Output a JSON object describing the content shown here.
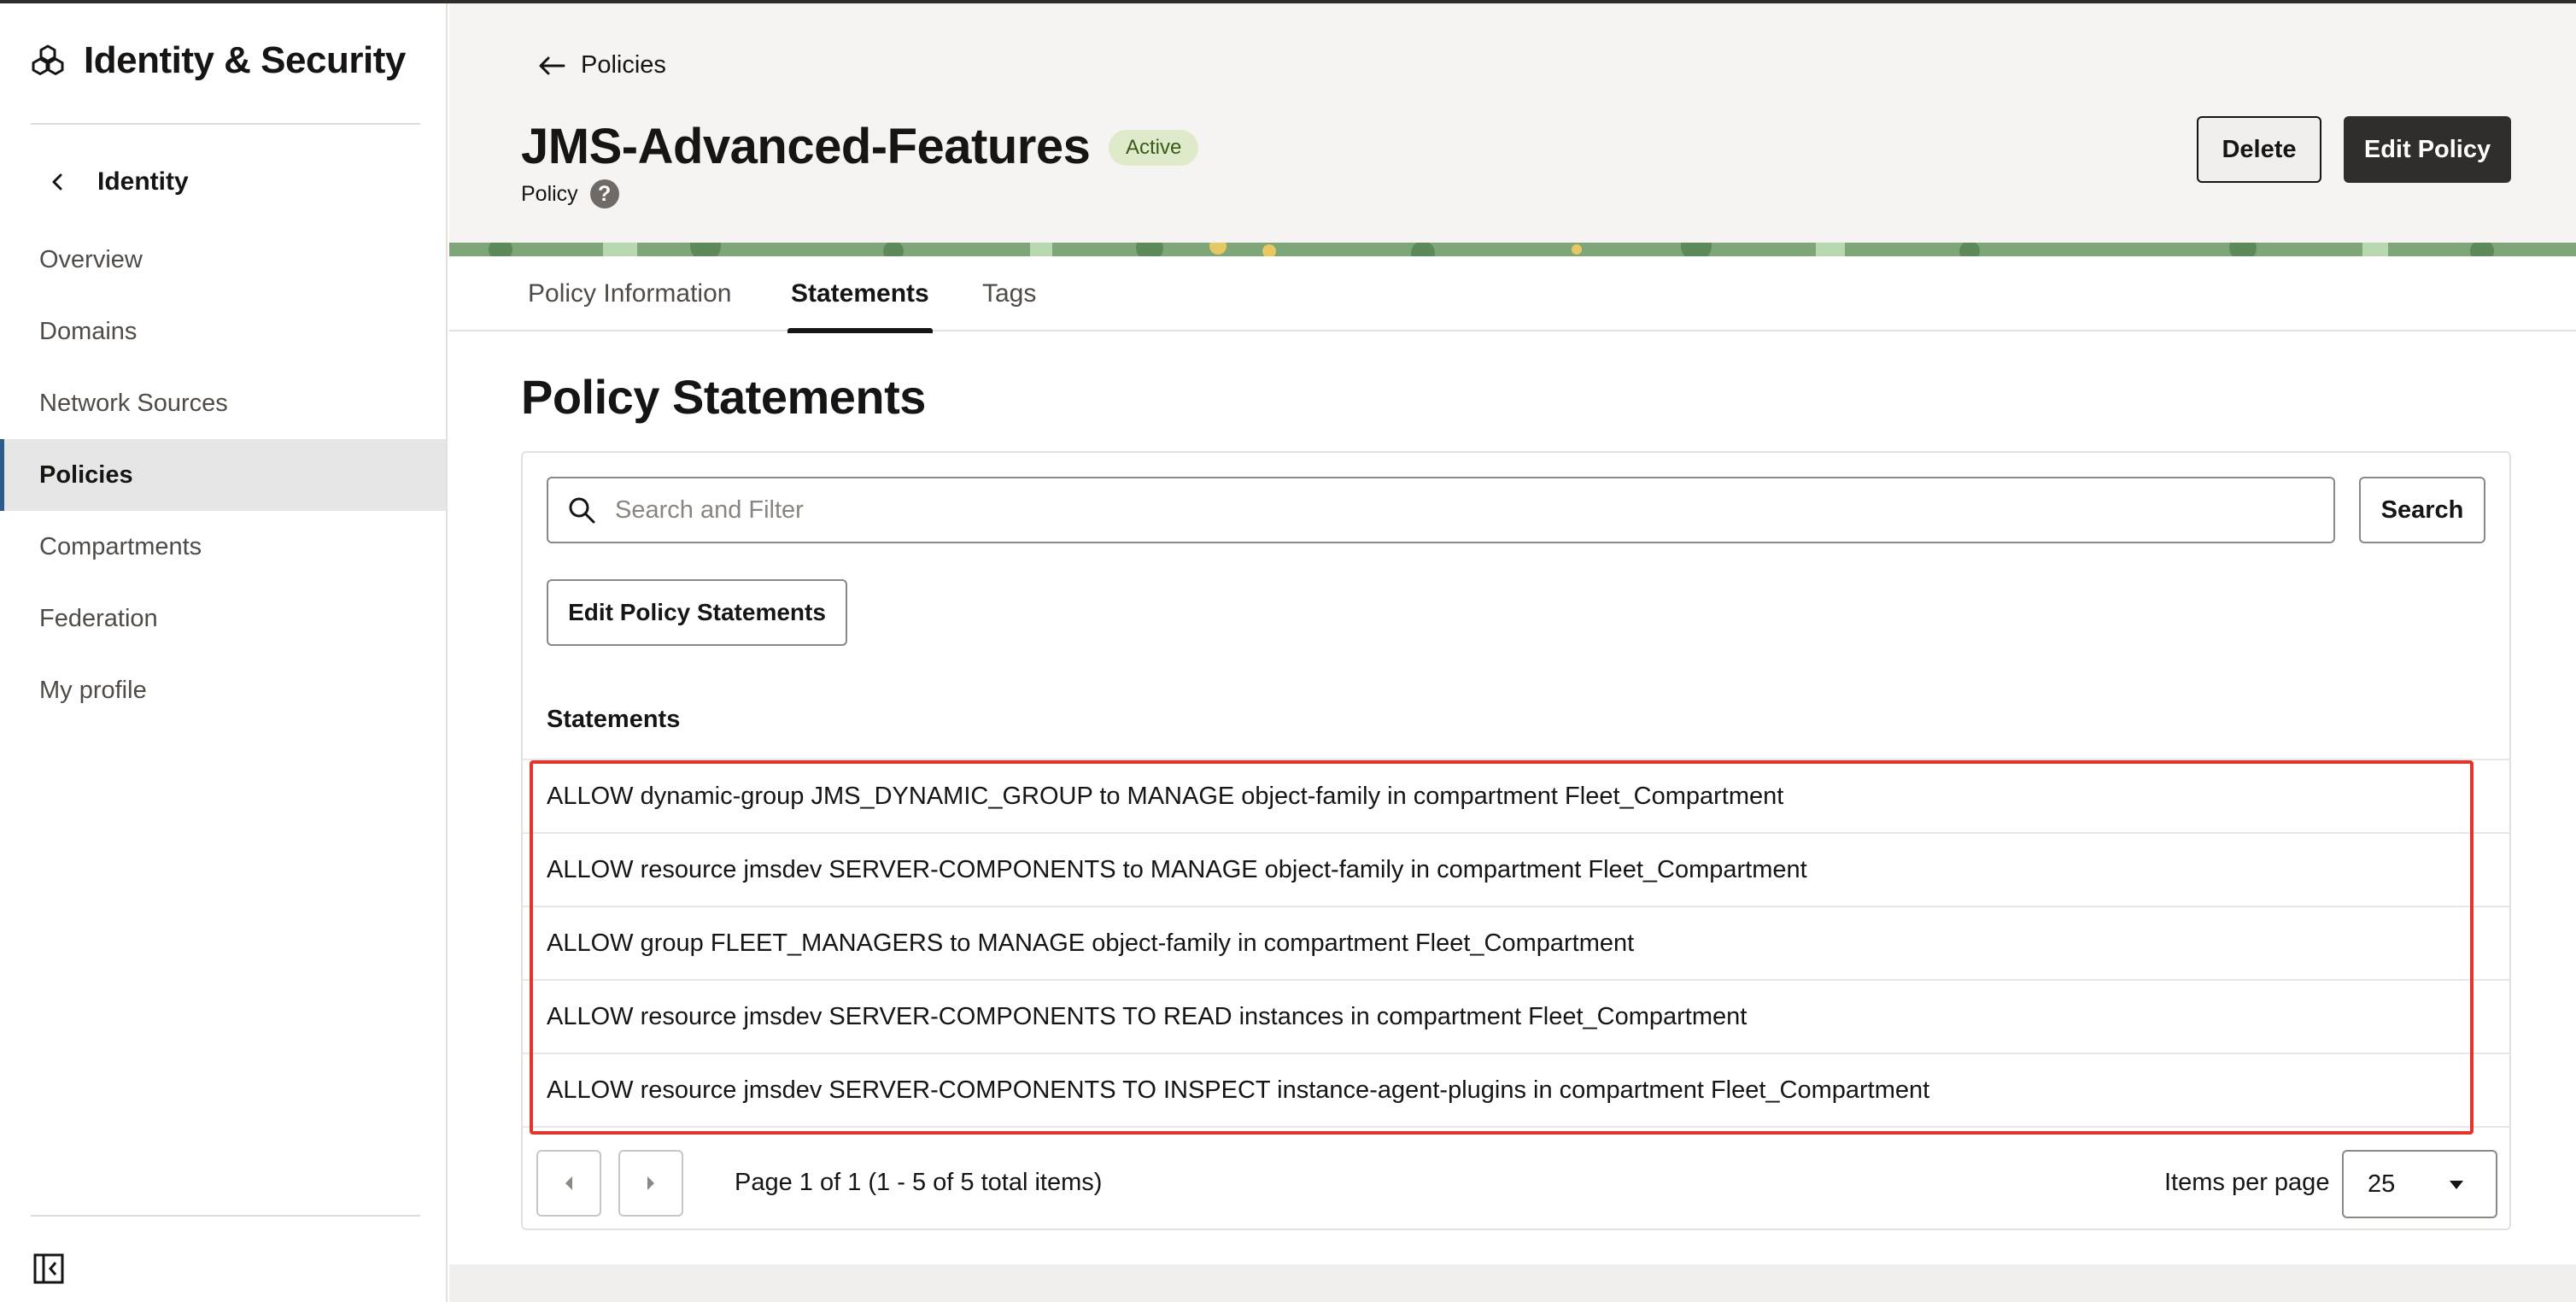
{
  "sidebar": {
    "title": "Identity & Security",
    "logo_icon": "cubes-icon",
    "back_label": "Identity",
    "items": [
      {
        "label": "Overview",
        "active": false
      },
      {
        "label": "Domains",
        "active": false
      },
      {
        "label": "Network Sources",
        "active": false
      },
      {
        "label": "Policies",
        "active": true
      },
      {
        "label": "Compartments",
        "active": false
      },
      {
        "label": "Federation",
        "active": false
      },
      {
        "label": "My profile",
        "active": false
      }
    ],
    "collapse_icon": "collapse-sidebar-icon"
  },
  "header": {
    "back_link": "Policies",
    "title": "JMS-Advanced-Features",
    "status": "Active",
    "subtitle": "Policy",
    "help_glyph": "?",
    "delete_label": "Delete",
    "edit_label": "Edit Policy"
  },
  "tabs": [
    {
      "label": "Policy Information",
      "active": false
    },
    {
      "label": "Statements",
      "active": true
    },
    {
      "label": "Tags",
      "active": false
    }
  ],
  "statements_section": {
    "title": "Policy Statements",
    "search_placeholder": "Search and Filter",
    "search_button": "Search",
    "edit_statements_button": "Edit Policy Statements",
    "list_header": "Statements",
    "rows": [
      "ALLOW dynamic-group JMS_DYNAMIC_GROUP to MANAGE object-family in compartment Fleet_Compartment",
      "ALLOW resource jmsdev SERVER-COMPONENTS to MANAGE object-family in compartment Fleet_Compartment",
      "ALLOW group FLEET_MANAGERS to MANAGE object-family in compartment Fleet_Compartment",
      "ALLOW resource jmsdev SERVER-COMPONENTS TO READ instances in compartment Fleet_Compartment",
      "ALLOW resource jmsdev SERVER-COMPONENTS TO INSPECT instance-agent-plugins in compartment Fleet_Compartment"
    ]
  },
  "pagination": {
    "text": "Page 1 of 1 (1 - 5 of 5 total items)",
    "items_per_page_label": "Items per page",
    "items_per_page_value": "25"
  },
  "colors": {
    "accent_dark": "#312d2a",
    "active_badge_bg": "#dfeacb",
    "highlight_border": "#e0362b",
    "active_nav_marker": "#2c5c8a"
  }
}
